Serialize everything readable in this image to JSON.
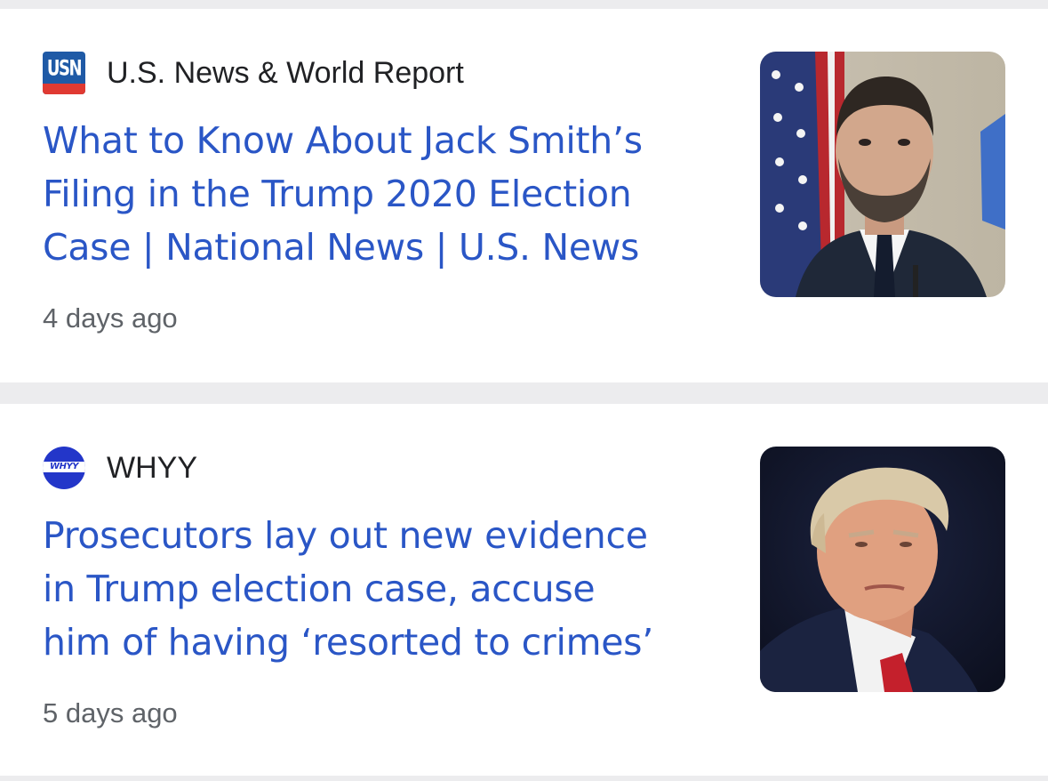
{
  "articles": [
    {
      "source": "U.S. News & World Report",
      "source_logo": {
        "icon": "usn-logo-icon",
        "text": "USN",
        "colors": [
          "#1f5aa6",
          "#e03a32"
        ]
      },
      "headline_lines": [
        "What to Know About Jack Smith’s",
        "Filing in the Trump 2020 Election",
        "Case | National News | U.S. News"
      ],
      "time": "4 days ago",
      "thumbnail": "photo-man-beard-flag"
    },
    {
      "source": "WHYY",
      "source_logo": {
        "icon": "whyy-logo-icon",
        "text": "WHYY",
        "colors": [
          "#2336c9"
        ]
      },
      "headline_lines": [
        "Prosecutors lay out new evidence",
        "in Trump election case, accuse",
        "him of having ‘resorted to crimes’"
      ],
      "time": "5 days ago",
      "thumbnail": "photo-man-dark-background"
    }
  ],
  "colors": {
    "headline": "#2a56c6",
    "meta": "#5f6368",
    "separator": "#ececee"
  }
}
